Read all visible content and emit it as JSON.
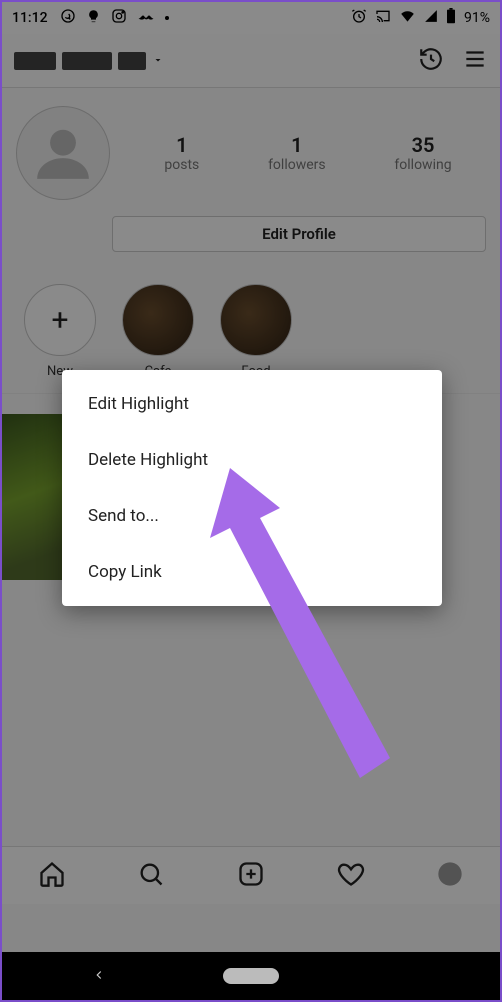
{
  "status": {
    "time": "11:12",
    "battery": "91%"
  },
  "stats": {
    "posts": {
      "count": "1",
      "label": "posts"
    },
    "followers": {
      "count": "1",
      "label": "followers"
    },
    "following": {
      "count": "35",
      "label": "following"
    }
  },
  "edit_profile_label": "Edit Profile",
  "highlights": {
    "new": "New",
    "item1": "Cafe",
    "item2": "Food"
  },
  "dialog": {
    "edit": "Edit Highlight",
    "delete": "Delete Highlight",
    "send": "Send to...",
    "copy": "Copy Link"
  }
}
